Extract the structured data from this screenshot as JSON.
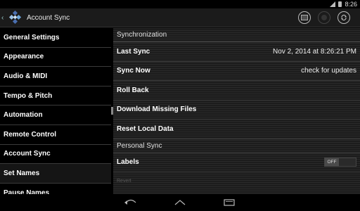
{
  "status_bar": {
    "time": "8:26"
  },
  "action_bar": {
    "title": "Account Sync",
    "actions": [
      "keyboard-icon",
      "record-icon",
      "sync-icon"
    ]
  },
  "sidebar": {
    "items": [
      {
        "label": "General Settings"
      },
      {
        "label": "Appearance"
      },
      {
        "label": "Audio & MIDI"
      },
      {
        "label": "Tempo & Pitch"
      },
      {
        "label": "Automation"
      },
      {
        "label": "Remote Control"
      },
      {
        "label": "Account Sync"
      },
      {
        "label": "Set Names",
        "active": true
      },
      {
        "label": "Pause Names"
      }
    ]
  },
  "main": {
    "synchronization_header": "Synchronization",
    "last_sync": {
      "label": "Last Sync",
      "value": "Nov 2, 2014 at 8:26:21 PM"
    },
    "sync_now": {
      "label": "Sync Now",
      "value": "check for updates"
    },
    "roll_back": {
      "label": "Roll Back"
    },
    "download_missing": {
      "label": "Download Missing Files"
    },
    "reset_local": {
      "label": "Reset Local Data"
    },
    "personal_sync_header": "Personal Sync",
    "labels": {
      "label": "Labels",
      "toggle": "OFF"
    },
    "revert": {
      "label": "Revert"
    }
  },
  "colors": {
    "accent": "#33b5e5",
    "background": "#000000"
  }
}
